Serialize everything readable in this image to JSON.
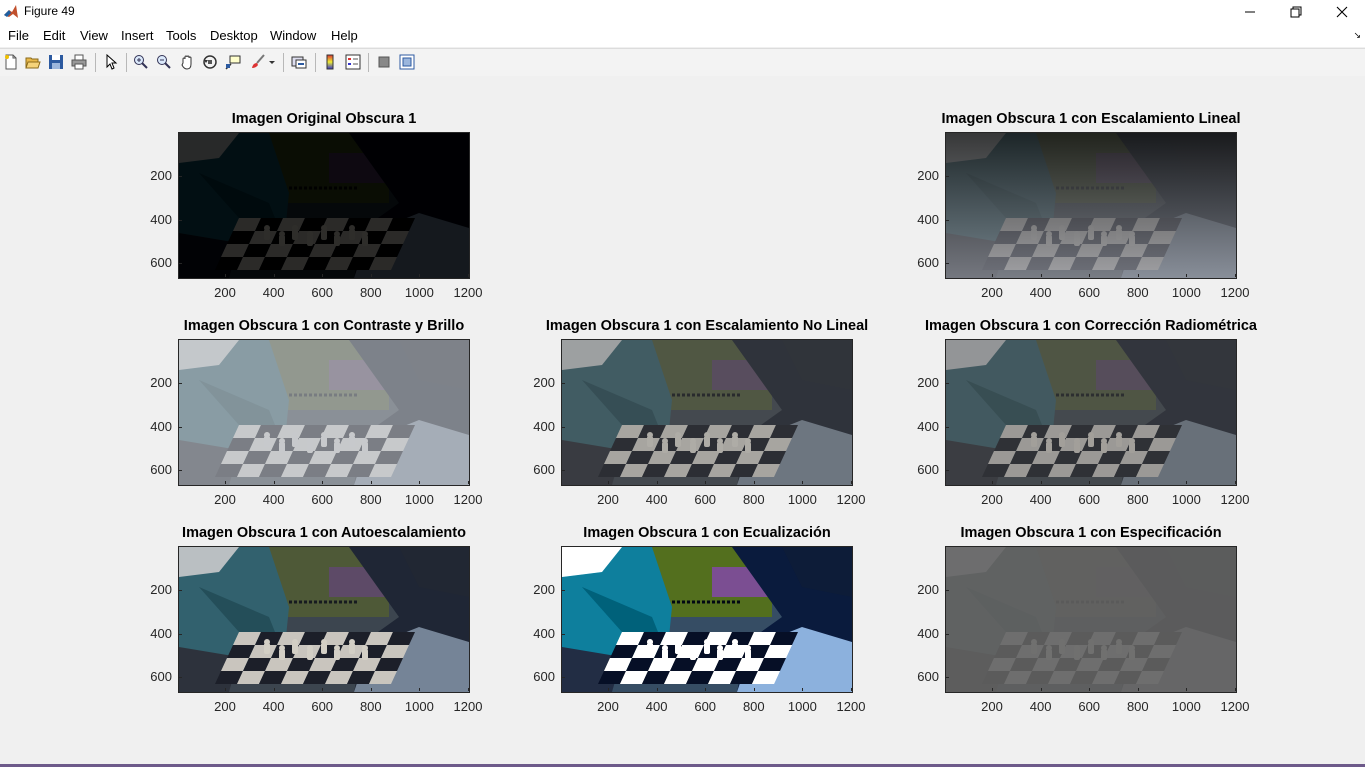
{
  "window": {
    "title": "Figure 49",
    "icon": "matlab-icon"
  },
  "menu": [
    "File",
    "Edit",
    "View",
    "Insert",
    "Tools",
    "Desktop",
    "Window",
    "Help"
  ],
  "toolbar": [
    "new-figure-icon",
    "open-file-icon",
    "save-icon",
    "print-icon",
    "edit-plot-icon",
    "zoom-in-icon",
    "zoom-out-icon",
    "pan-icon",
    "rotate-3d-icon",
    "data-cursor-icon",
    "brush-icon",
    "link-plot-icon",
    "colorbar-icon",
    "legend-icon",
    "hide-plot-tools-icon",
    "show-plot-tools-icon"
  ],
  "x_ticks": [
    "200",
    "400",
    "600",
    "800",
    "1000",
    "1200"
  ],
  "y_ticks": [
    "200",
    "400",
    "600"
  ],
  "subplots": [
    {
      "title": "Imagen Original Obscura 1",
      "variant": "original"
    },
    {
      "title": "Imagen Obscura 1 con Escalamiento Lineal",
      "variant": "lineal"
    },
    {
      "title": "Imagen Obscura 1 con Contraste y Brillo",
      "variant": "contraste"
    },
    {
      "title": "Imagen Obscura 1 con Escalamiento No Lineal",
      "variant": "nolineal"
    },
    {
      "title": "Imagen Obscura 1 con Corrección Radiométrica",
      "variant": "radiometrica"
    },
    {
      "title": "Imagen Obscura 1 con Autoescalamiento",
      "variant": "auto"
    },
    {
      "title": "Imagen Obscura 1 con Ecualización",
      "variant": "ecualizacion"
    },
    {
      "title": "Imagen Obscura 1 con Especificación",
      "variant": "especificacion"
    }
  ]
}
